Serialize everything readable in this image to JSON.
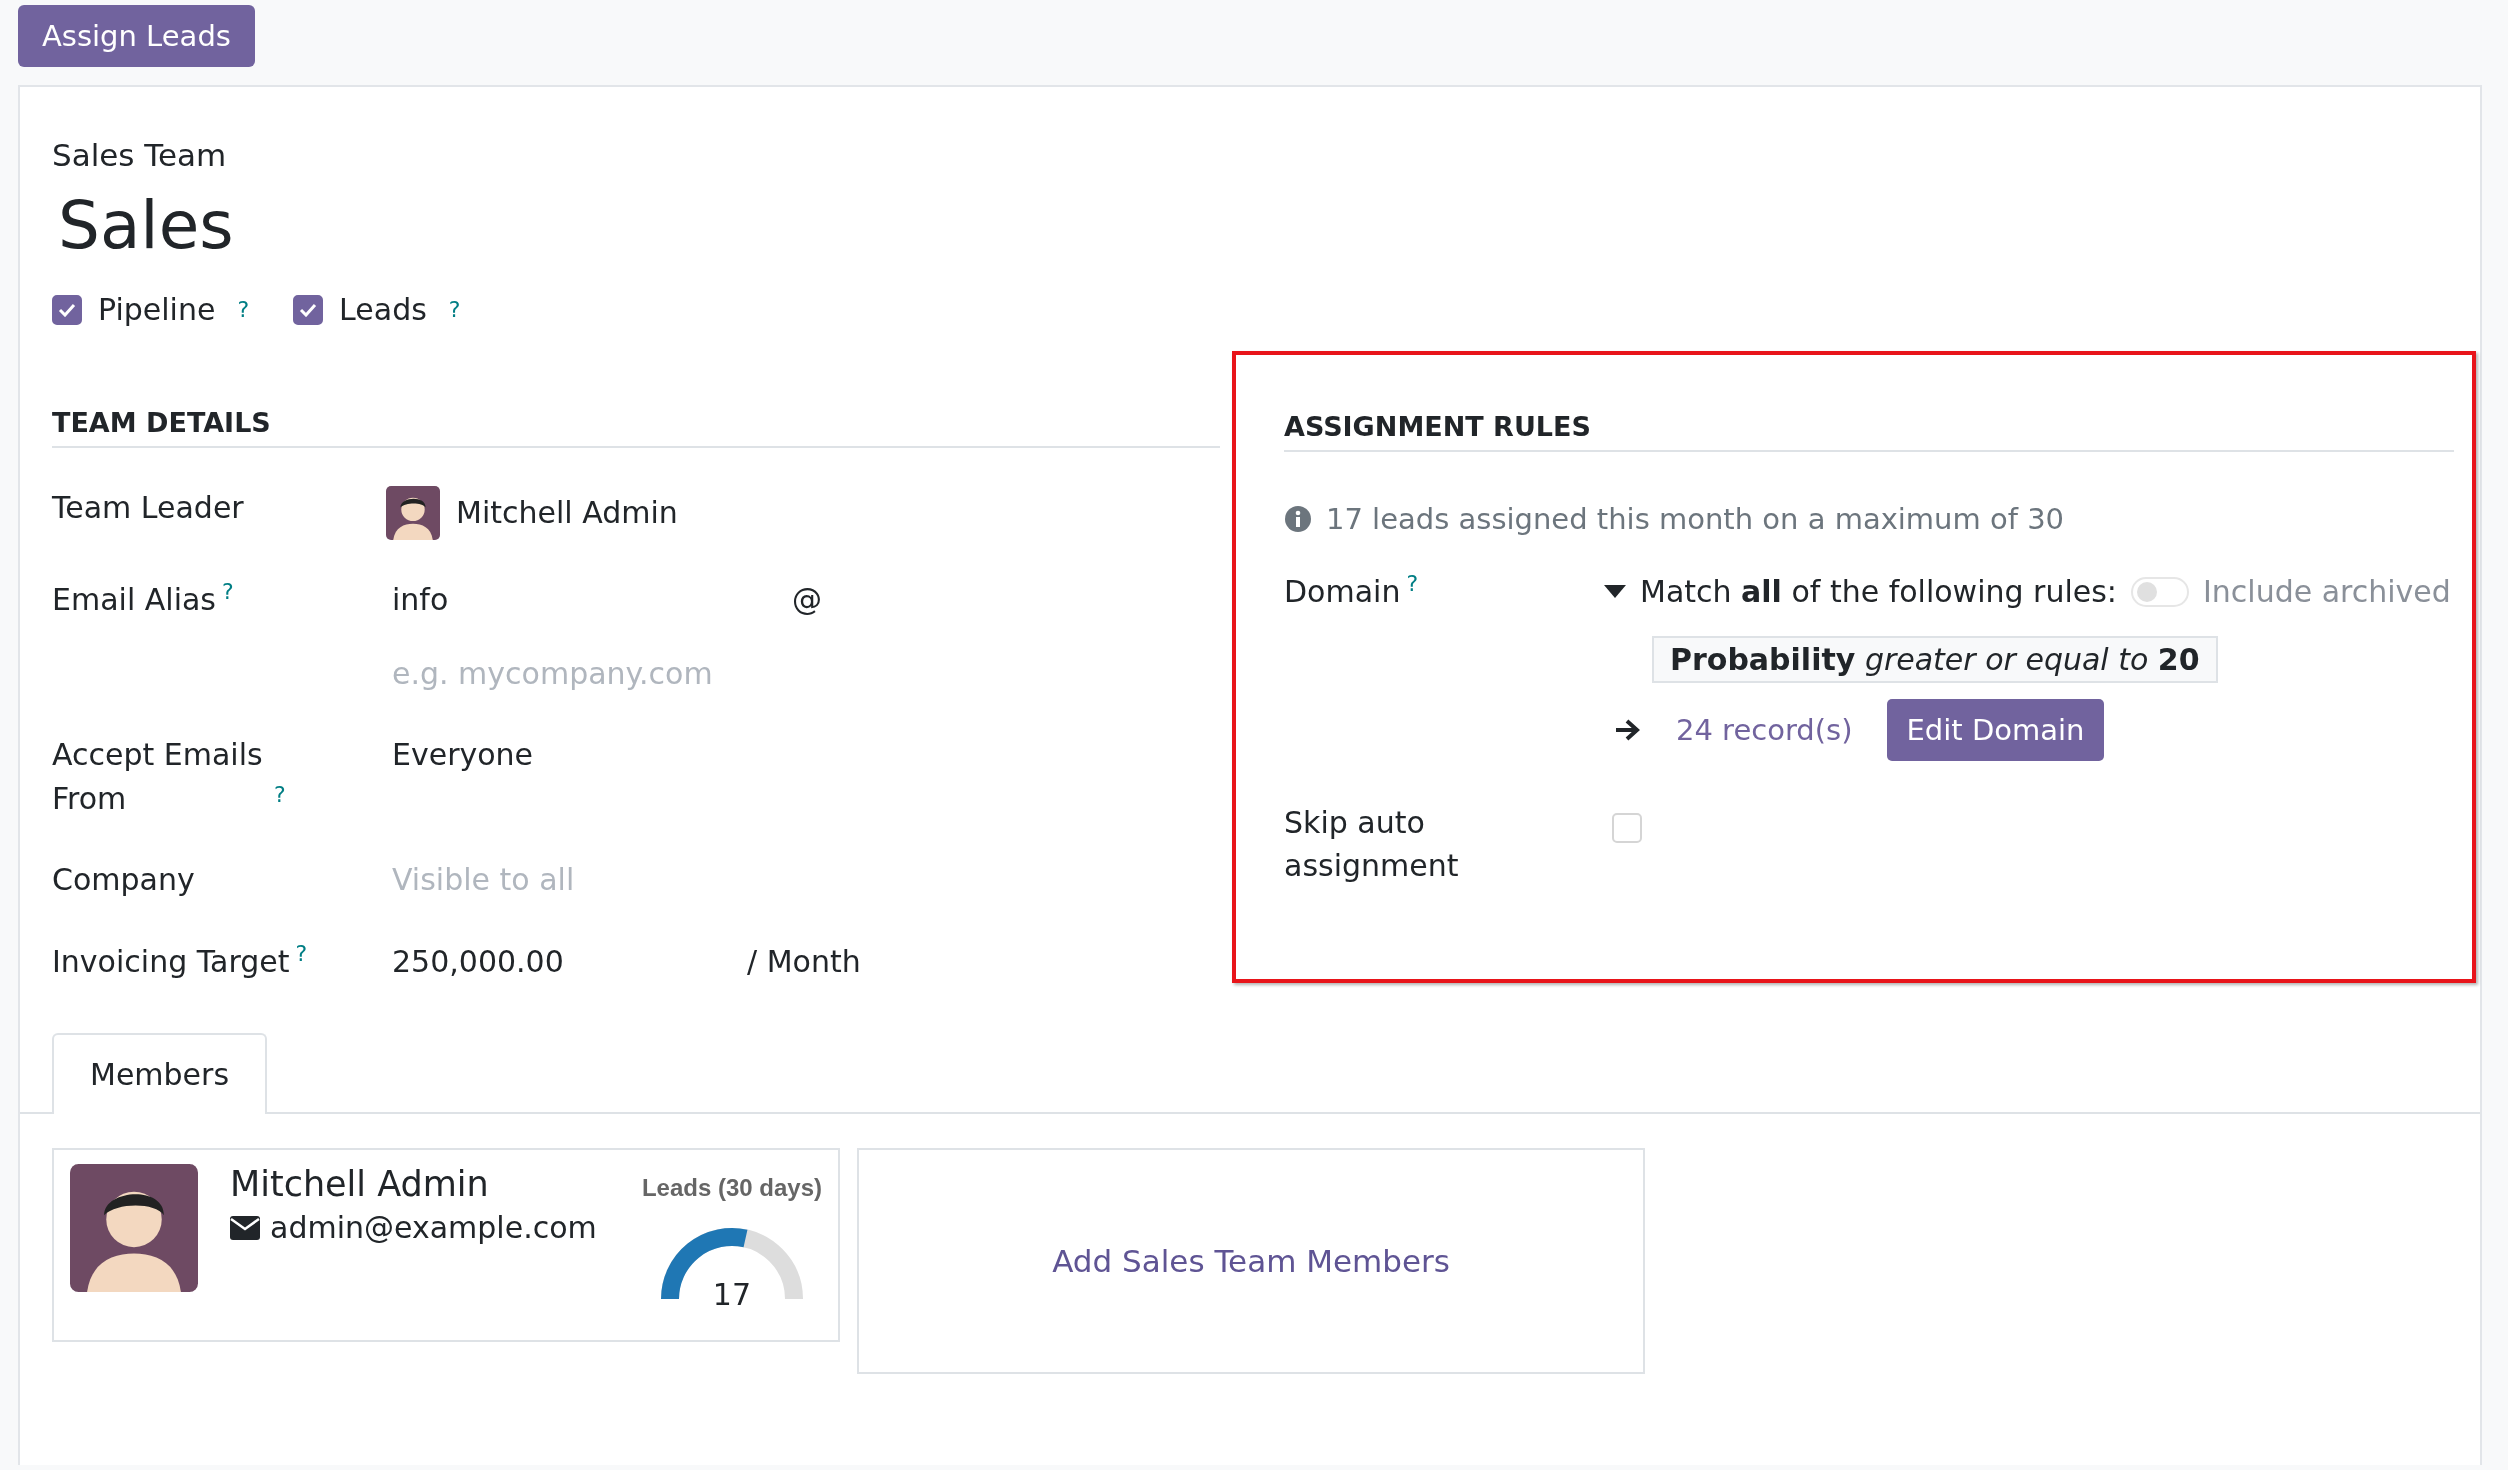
{
  "action_button": "Assign Leads",
  "form": {
    "caption": "Sales Team",
    "name": "Sales",
    "options": [
      {
        "label": "Pipeline",
        "help": "?",
        "checked": true
      },
      {
        "label": "Leads",
        "help": "?",
        "checked": true
      }
    ]
  },
  "team_details": {
    "heading": "TEAM DETAILS",
    "fields": [
      {
        "kind": "user",
        "label": "Team Leader",
        "value": "Mitchell Admin"
      },
      {
        "kind": "alias",
        "label": "Email Alias",
        "help": "?",
        "value": "info",
        "separator": "@",
        "placeholder": "e.g. mycompany.com"
      },
      {
        "kind": "text",
        "label": "Accept Emails From",
        "help": "?",
        "value": "Everyone"
      },
      {
        "kind": "empty",
        "label": "Company",
        "placeholder": "Visible to all"
      },
      {
        "kind": "amount",
        "label": "Invoicing Target",
        "help": "?",
        "value": "250,000.00",
        "suffix": "/ Month"
      }
    ]
  },
  "assignment_rules": {
    "heading": "ASSIGNMENT RULES",
    "info": "17 leads assigned this month on a maximum of 30",
    "domain": {
      "label": "Domain",
      "help": "?",
      "expanded": true,
      "match": "Match **all** of the following rules:",
      "include_archived": {
        "label": "Include archived",
        "on": false
      },
      "rule": "**Probability** *greater or equal to* **20**",
      "records": "24 record(s)",
      "edit_button": "Edit Domain"
    },
    "skip": {
      "label": "Skip auto assignment",
      "checked": false
    }
  },
  "tabs": [
    {
      "label": "Members",
      "selected": true
    }
  ],
  "members": [
    {
      "name": "Mitchell Admin",
      "email": "admin@example.com",
      "gauge_label": "Leads (30 days)",
      "gauge_value": "17",
      "level": 0.57
    }
  ],
  "add_members": "Add Sales Team Members"
}
